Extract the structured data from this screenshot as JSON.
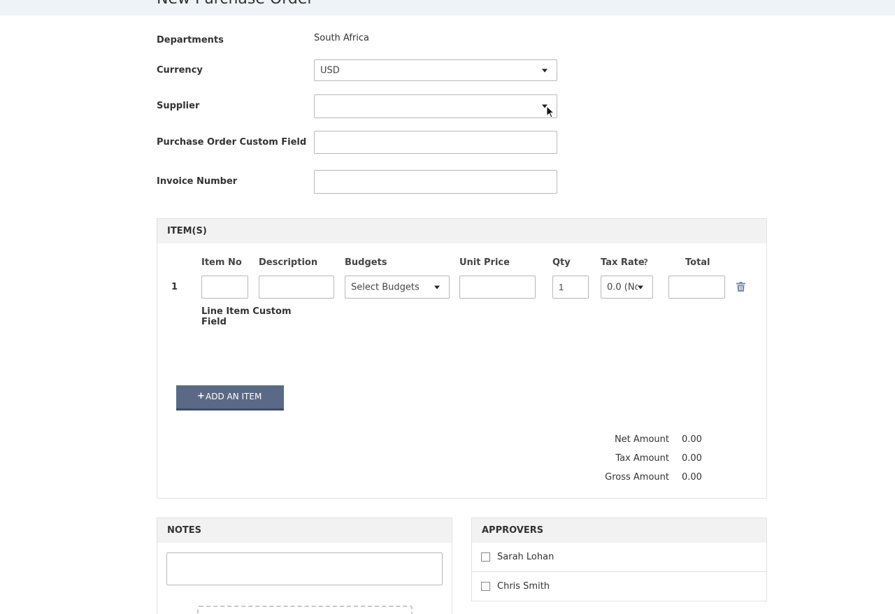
{
  "page": {
    "title": "New Purchase Order"
  },
  "form": {
    "departments_label": "Departments",
    "departments_value": "South Africa",
    "currency_label": "Currency",
    "currency_value": "USD",
    "supplier_label": "Supplier",
    "supplier_value": "",
    "custom_field_label": "Purchase Order Custom Field",
    "custom_field_value": "",
    "invoice_label": "Invoice Number",
    "invoice_value": ""
  },
  "items": {
    "title": "ITEM(S)",
    "columns": {
      "item_no": "Item No",
      "description": "Description",
      "budgets": "Budgets",
      "unit_price": "Unit Price",
      "qty": "Qty",
      "tax_rate": "Tax Rate",
      "tax_help": "?",
      "total": "Total"
    },
    "rows": [
      {
        "index": "1",
        "item_no": "",
        "description": "",
        "budgets": "Select Budgets",
        "unit_price": "",
        "qty": "1",
        "tax_rate": "0.0 (No",
        "total": ""
      }
    ],
    "line_custom_label_1": "Line Item Custom",
    "line_custom_label_2": "Field",
    "add_button": "ADD AN ITEM",
    "add_button_icon": "plus-icon"
  },
  "summary": {
    "net_label": "Net Amount",
    "net_value": "0.00",
    "tax_label": "Tax Amount",
    "tax_value": "0.00",
    "gross_label": "Gross Amount",
    "gross_value": "0.00"
  },
  "notes": {
    "title": "NOTES",
    "value": ""
  },
  "approvers": {
    "title": "APPROVERS",
    "list": [
      {
        "name": "Sarah Lohan",
        "checked": false
      },
      {
        "name": "Chris Smith",
        "checked": false
      }
    ]
  },
  "icons": {
    "delete": "trash-icon",
    "cursor": "mouse-cursor-icon",
    "dropdown": "chevron-down-icon"
  },
  "colors": {
    "accent_button": "#5a6a86",
    "header_bar": "#edf3f6",
    "panel_header": "#f2f2f2",
    "trash": "#7a8ba6"
  }
}
